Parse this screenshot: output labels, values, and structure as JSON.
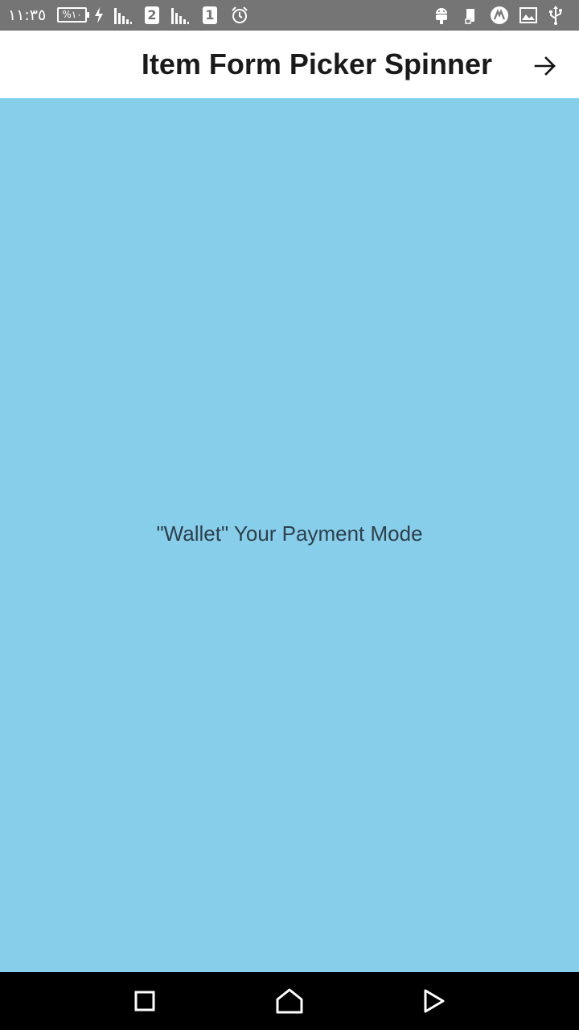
{
  "status_bar": {
    "time": "١١:٣٥",
    "battery_text": "%١٠",
    "sim1_badge": "2",
    "sim2_badge": "1",
    "icons": [
      "charging-icon",
      "signal-icon",
      "sim-badge",
      "signal-icon",
      "sim-badge",
      "alarm-icon",
      "android-icon",
      "device-icon",
      "app-icon",
      "image-icon",
      "usb-icon"
    ]
  },
  "app_bar": {
    "title": "Item Form Picker Spinner",
    "action_icon": "arrow-right-icon"
  },
  "content": {
    "background_color": "#87ceeb",
    "payment_mode_text": "\"Wallet\" Your Payment Mode"
  },
  "nav_bar": {
    "buttons": [
      "recents-icon",
      "home-icon",
      "back-icon"
    ]
  }
}
